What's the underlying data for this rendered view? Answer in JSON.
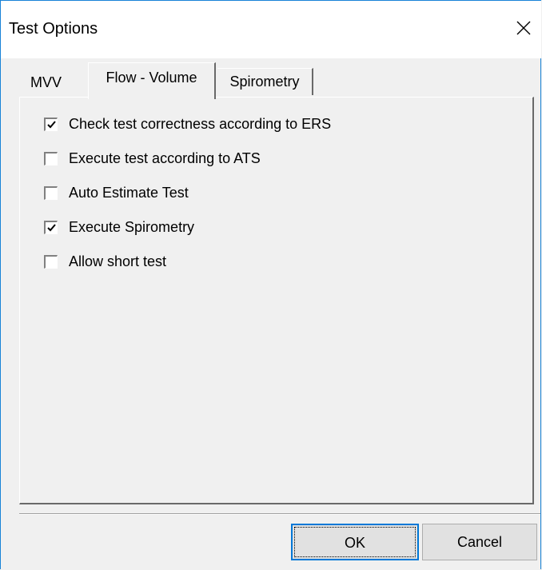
{
  "window": {
    "title": "Test Options",
    "close_icon": "close-icon"
  },
  "tabs": [
    {
      "label": "MVV",
      "active": false
    },
    {
      "label": "Flow - Volume",
      "active": true
    },
    {
      "label": "Spirometry",
      "active": false
    }
  ],
  "options": [
    {
      "label": "Check test correctness according to ERS",
      "checked": true
    },
    {
      "label": "Execute test according to ATS",
      "checked": false
    },
    {
      "label": "Auto Estimate Test",
      "checked": false
    },
    {
      "label": "Execute Spirometry",
      "checked": true
    },
    {
      "label": "Allow short test",
      "checked": false
    }
  ],
  "buttons": {
    "ok_label": "OK",
    "cancel_label": "Cancel"
  },
  "colors": {
    "window_border": "#1883d7",
    "face": "#f0f0f0",
    "default_button_border": "#0078d7"
  }
}
